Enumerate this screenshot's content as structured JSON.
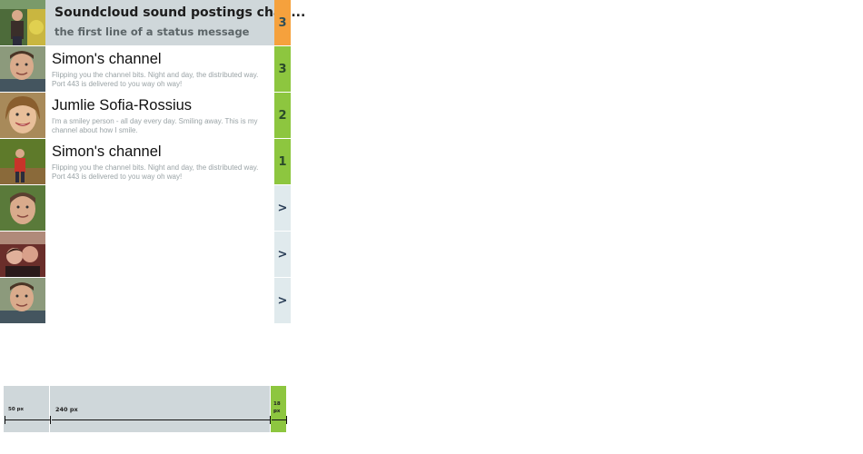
{
  "header": {
    "title": "Soundcloud sound postings chan...",
    "subtitle": "the first line of a status message",
    "badge": "3"
  },
  "channels": [
    {
      "name": "Simon's channel",
      "desc": "Flipping you the channel bits. Night and day, the distributed way. Port 443 is delivered to you way oh way!",
      "badge": "3"
    },
    {
      "name": "Jumlie Sofia-Rossius",
      "desc": "I'm a smiley person - all day every day. Smiling away. This is my channel about how I smile.",
      "badge": "2"
    },
    {
      "name": "Simon's channel",
      "desc": "Flipping you the channel bits. Night and day, the distributed way. Port 443 is delivered to you way oh way!",
      "badge": "1"
    }
  ],
  "empty_rows": [
    {
      "badge": ">"
    },
    {
      "badge": ">"
    },
    {
      "badge": ">"
    }
  ],
  "dimensions": {
    "avatar": "50 px",
    "content": "240 px",
    "badge": "18 px"
  },
  "colors": {
    "header_bg": "#cfd7da",
    "badge_orange": "#f5a13d",
    "badge_green": "#8dc63f",
    "badge_arrow_bg": "#e0eaed"
  }
}
